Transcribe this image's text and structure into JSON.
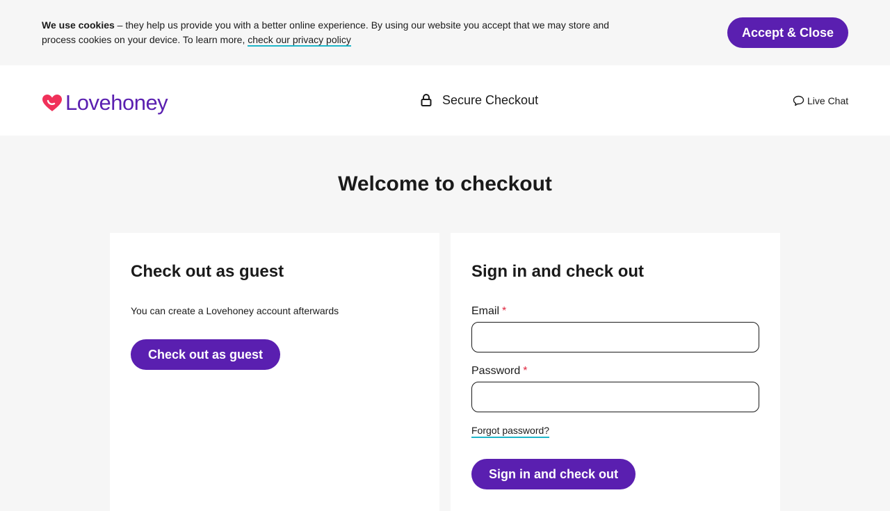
{
  "cookie_banner": {
    "bold_lead": "We use cookies",
    "text": " – they help us provide you with a better online experience. By using our website you accept that we may store and process cookies on your device. To learn more, ",
    "link_label": "check our privacy policy",
    "accept_label": "Accept & Close"
  },
  "header": {
    "logo_text": "Lovehoney",
    "secure_label": "Secure Checkout",
    "live_chat_label": "Live Chat",
    "icons": {
      "logo": "heart-logo-icon",
      "secure": "lock-icon",
      "chat": "chat-bubble-icon"
    }
  },
  "main": {
    "title": "Welcome to checkout",
    "guest": {
      "title": "Check out as guest",
      "subtitle": "You can create a Lovehoney account afterwards",
      "button_label": "Check out as guest"
    },
    "signin": {
      "title": "Sign in and check out",
      "email_label": "Email",
      "email_value": "",
      "password_label": "Password",
      "password_value": "",
      "required_marker": "*",
      "forgot_label": "Forgot password?",
      "button_label": "Sign in and check out"
    }
  },
  "colors": {
    "brand_purple": "#5a1fb0",
    "link_underline": "#1fb6c9",
    "required_red": "#e0263f",
    "logo_heart": "#f0315a",
    "page_bg": "#f6f6f6"
  }
}
